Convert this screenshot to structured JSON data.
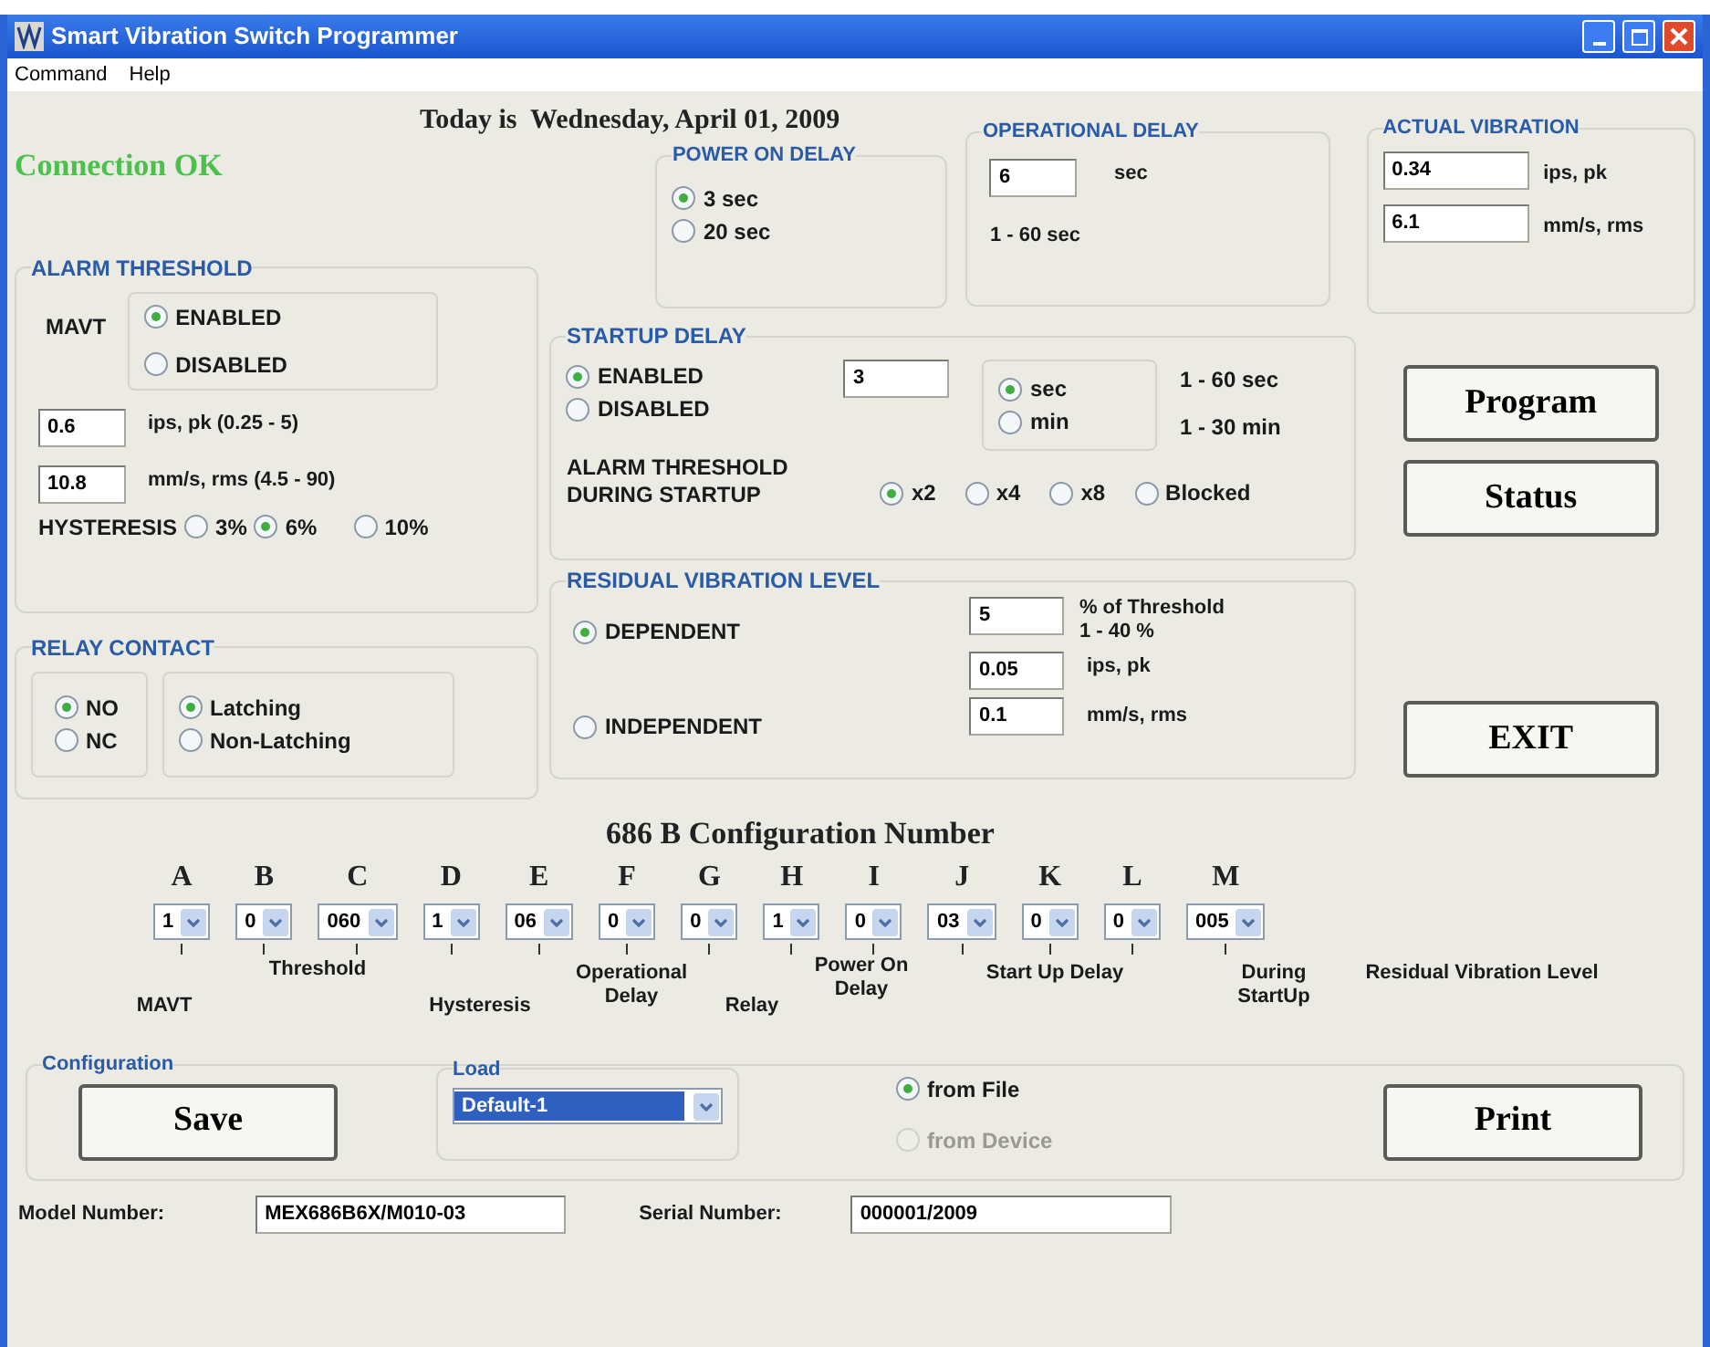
{
  "window": {
    "title": "Smart Vibration Switch Programmer"
  },
  "menu": [
    "Command",
    "Help"
  ],
  "connection_status": "Connection OK",
  "date_text": "Today is  Wednesday, April 01, 2009",
  "alarm_threshold": {
    "title": "ALARM THRESHOLD",
    "mavt_label": "MAVT",
    "mavt_options": [
      {
        "label": "ENABLED",
        "selected": true
      },
      {
        "label": "DISABLED",
        "selected": false
      }
    ],
    "ips_value": "0.6",
    "ips_label": "ips, pk (0.25 - 5)",
    "mms_value": "10.8",
    "mms_label": "mm/s, rms (4.5 - 90)",
    "hysteresis_label": "HYSTERESIS",
    "hysteresis_options": [
      {
        "label": "3%",
        "selected": false
      },
      {
        "label": "6%",
        "selected": true
      },
      {
        "label": "10%",
        "selected": false
      }
    ]
  },
  "relay_contact": {
    "title": "RELAY CONTACT",
    "contact_options": [
      {
        "label": "NO",
        "selected": true
      },
      {
        "label": "NC",
        "selected": false
      }
    ],
    "latch_options": [
      {
        "label": "Latching",
        "selected": true
      },
      {
        "label": "Non-Latching",
        "selected": false
      }
    ]
  },
  "power_on_delay": {
    "title": "POWER ON DELAY",
    "options": [
      {
        "label": "3 sec",
        "selected": true
      },
      {
        "label": "20 sec",
        "selected": false
      }
    ]
  },
  "operational_delay": {
    "title": "OPERATIONAL DELAY",
    "value": "6",
    "unit": "sec",
    "range": "1 - 60 sec"
  },
  "actual_vibration": {
    "title": "ACTUAL VIBRATION",
    "ips_value": "0.34",
    "ips_label": "ips, pk",
    "mms_value": "6.1",
    "mms_label": "mm/s, rms"
  },
  "startup_delay": {
    "title": "STARTUP DELAY",
    "options": [
      {
        "label": "ENABLED",
        "selected": true
      },
      {
        "label": "DISABLED",
        "selected": false
      }
    ],
    "value": "3",
    "unit_options": [
      {
        "label": "sec",
        "selected": true
      },
      {
        "label": "min",
        "selected": false
      }
    ],
    "ranges": [
      "1 - 60 sec",
      "1 - 30 min"
    ],
    "threshold_label": "ALARM THRESHOLD DURING STARTUP",
    "multiplier_options": [
      {
        "label": "x2",
        "selected": true
      },
      {
        "label": "x4",
        "selected": false
      },
      {
        "label": "x8",
        "selected": false
      },
      {
        "label": "Blocked",
        "selected": false
      }
    ]
  },
  "residual_vibration": {
    "title": "RESIDUAL VIBRATION LEVEL",
    "options": [
      {
        "label": "DEPENDENT",
        "selected": true
      },
      {
        "label": "INDEPENDENT",
        "selected": false
      }
    ],
    "percent_value": "5",
    "percent_label": "% of Threshold",
    "percent_range": "1 - 40 %",
    "ips_value": "0.05",
    "ips_label": "ips, pk",
    "mms_value": "0.1",
    "mms_label": "mm/s, rms"
  },
  "side_buttons": [
    "Program",
    "Status",
    "EXIT"
  ],
  "configuration_number": {
    "title": "686 B Configuration Number",
    "fields": [
      {
        "letter": "A",
        "value": "1"
      },
      {
        "letter": "B",
        "value": "0"
      },
      {
        "letter": "C",
        "value": "060"
      },
      {
        "letter": "D",
        "value": "1"
      },
      {
        "letter": "E",
        "value": "06"
      },
      {
        "letter": "F",
        "value": "0"
      },
      {
        "letter": "G",
        "value": "0"
      },
      {
        "letter": "H",
        "value": "1"
      },
      {
        "letter": "I",
        "value": "0"
      },
      {
        "letter": "J",
        "value": "03"
      },
      {
        "letter": "K",
        "value": "0"
      },
      {
        "letter": "L",
        "value": "0"
      },
      {
        "letter": "M",
        "value": "005"
      }
    ],
    "labels": [
      "MAVT",
      "Threshold",
      "Hysteresis",
      "Operational Delay",
      "Relay",
      "Power On Delay",
      "Start Up  Delay",
      "During StartUp",
      "Residual Vibration Level"
    ]
  },
  "configuration": {
    "title": "Configuration",
    "save": "Save",
    "load_title": "Load",
    "load_value": "Default-1",
    "source_options": [
      {
        "label": "from File",
        "selected": true,
        "disabled": false
      },
      {
        "label": "from Device",
        "selected": false,
        "disabled": true
      }
    ],
    "print": "Print"
  },
  "model_number": {
    "label": "Model Number:",
    "value": "MEX686B6X/M010-03"
  },
  "serial_number": {
    "label": "Serial Number:",
    "value": "000001/2009"
  }
}
